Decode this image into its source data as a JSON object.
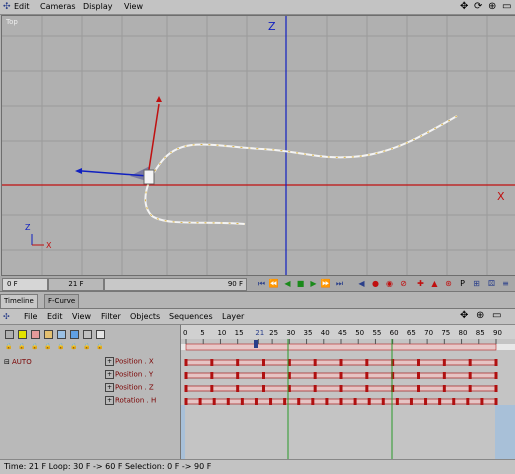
{
  "menubar": {
    "items": [
      "Edit",
      "Cameras",
      "Display",
      "View"
    ],
    "right_icons": [
      "move-icon",
      "rotate-view-icon",
      "zoom-icon",
      "maximize-icon"
    ]
  },
  "viewport": {
    "label": "Top",
    "axis_z": "Z",
    "axis_x": "X",
    "gizmo_z": "Z",
    "gizmo_x": "X"
  },
  "timeslider": {
    "start": "0 F",
    "current": "21 F",
    "end": "90 F"
  },
  "tabs": [
    "Timeline",
    "F-Curve"
  ],
  "timeline_menu": [
    "File",
    "Edit",
    "View",
    "Filter",
    "Objects",
    "Sequences",
    "Layer"
  ],
  "timeline": {
    "object": "AUTO",
    "ruler_ticks": [
      "0",
      "5",
      "10",
      "15",
      "21",
      "25",
      "30",
      "35",
      "40",
      "45",
      "50",
      "55",
      "60",
      "65",
      "70",
      "75",
      "80",
      "85",
      "90"
    ],
    "tracks": [
      "Position . X",
      "Position . Y",
      "Position . Z",
      "Rotation . H"
    ],
    "swatch_colors": [
      "#b0b0b0",
      "#e4e400",
      "#e49a9a",
      "#e4c070",
      "#9ac0e4",
      "#60a0e4",
      "#c0c0c0",
      "#e4e4e4"
    ]
  },
  "status": {
    "text": "Time: 21 F   Loop: 30 F -> 60 F   Selection: 0 F -> 90 F"
  }
}
